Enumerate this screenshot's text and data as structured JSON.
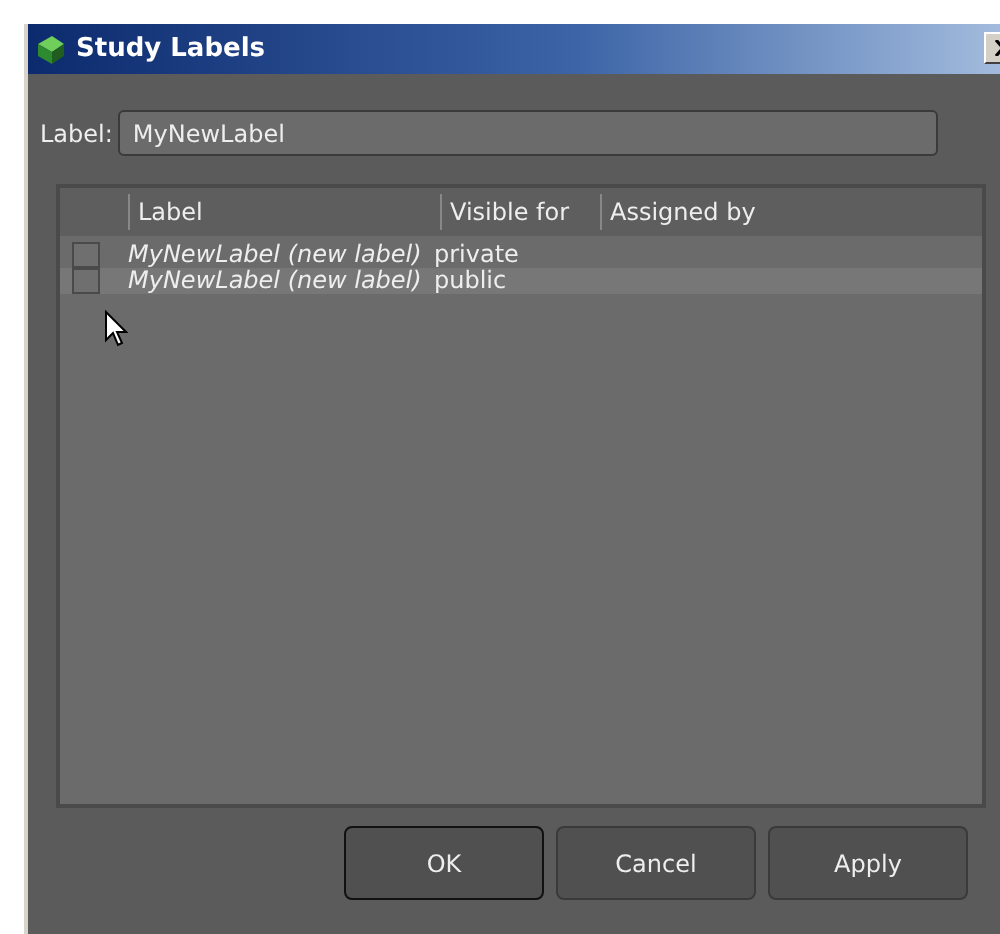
{
  "window": {
    "title": "Study Labels"
  },
  "label_field": {
    "label": "Label:",
    "value": "MyNewLabel"
  },
  "table": {
    "columns": [
      "Label",
      "Visible for",
      "Assigned by"
    ],
    "rows": [
      {
        "checked": false,
        "selected": false,
        "label": "MyNewLabel (new label)",
        "visible_for": "private"
      },
      {
        "checked": false,
        "selected": true,
        "label": "MyNewLabel (new label)",
        "visible_for": "public"
      }
    ]
  },
  "buttons": [
    {
      "label": "OK",
      "default": true
    },
    {
      "label": "Cancel",
      "default": false
    },
    {
      "label": "Apply",
      "default": false
    }
  ]
}
